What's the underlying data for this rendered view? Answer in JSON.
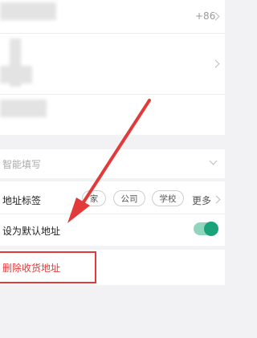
{
  "phone": {
    "prefix": "+86"
  },
  "smart_fill": {
    "label": "智能填写"
  },
  "address_tag": {
    "label": "地址标签",
    "tags": [
      "家",
      "公司",
      "学校"
    ],
    "more": "更多"
  },
  "default_address": {
    "label": "设为默认地址",
    "enabled": true
  },
  "delete": {
    "label": "删除收货地址"
  },
  "colors": {
    "accent": "#1aa37a",
    "danger": "#e23a3a"
  }
}
